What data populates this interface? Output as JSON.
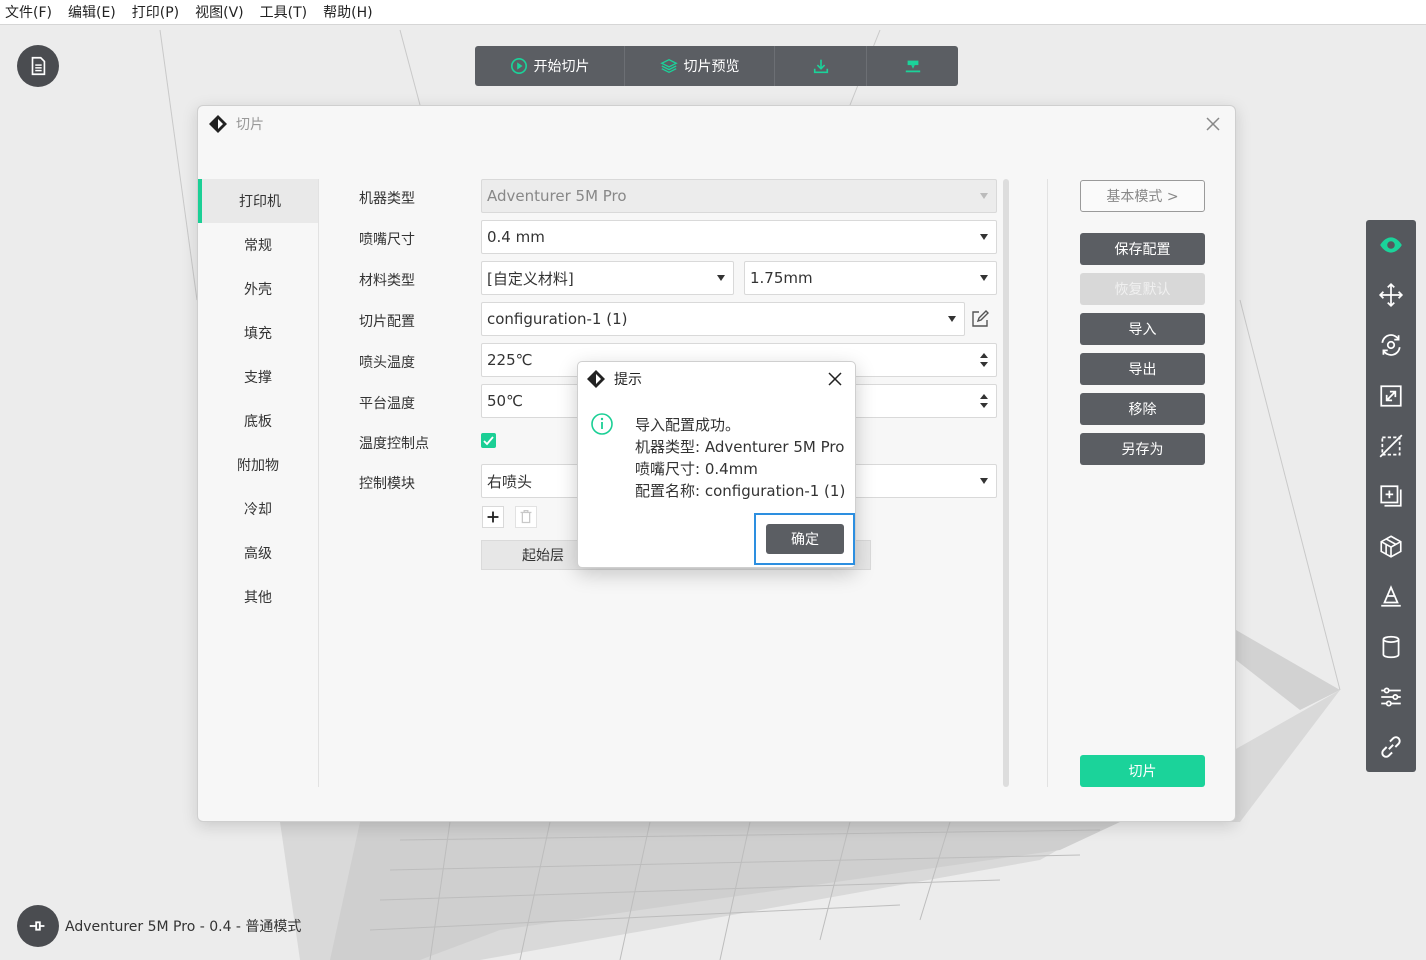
{
  "menu": [
    "文件(F)",
    "编辑(E)",
    "打印(P)",
    "视图(V)",
    "工具(T)",
    "帮助(H)"
  ],
  "toolbar": {
    "start_slice": "开始切片",
    "slice_preview": "切片预览"
  },
  "status": "Adventurer 5M Pro - 0.4 - 普通模式",
  "dialog": {
    "title": "切片",
    "nav": [
      "打印机",
      "常规",
      "外壳",
      "填充",
      "支撑",
      "底板",
      "附加物",
      "冷却",
      "高级",
      "其他"
    ],
    "fields": {
      "machine_type_label": "机器类型",
      "machine_type_value": "Adventurer 5M Pro",
      "nozzle_size_label": "喷嘴尺寸",
      "nozzle_size_value": "0.4 mm",
      "material_label": "材料类型",
      "material_value": "[自定义材料]",
      "filament_value": "1.75mm",
      "config_label": "切片配置",
      "config_value": "configuration-1 (1)",
      "nozzle_temp_label": "喷头温度",
      "nozzle_temp_value": "225℃",
      "bed_temp_label": "平台温度",
      "bed_temp_value": "50℃",
      "temp_ctrl_label": "温度控制点",
      "ctrl_module_label": "控制模块",
      "ctrl_module_value": "右喷头",
      "table_header": "起始层"
    },
    "side": {
      "basic_mode": "基本模式 >",
      "save_config": "保存配置",
      "restore_default": "恢复默认",
      "import": "导入",
      "export": "导出",
      "remove": "移除",
      "save_as": "另存为",
      "slice": "切片"
    }
  },
  "modal": {
    "title": "提示",
    "line1": "导入配置成功。",
    "line2": "机器类型: Adventurer 5M Pro",
    "line3": "喷嘴尺寸: 0.4mm",
    "line4": "配置名称: configuration-1 (1)",
    "ok": "确定"
  },
  "colors": {
    "accent": "#1bcf95",
    "button_dark": "#5b5e63",
    "focus": "#2d8fe0"
  }
}
